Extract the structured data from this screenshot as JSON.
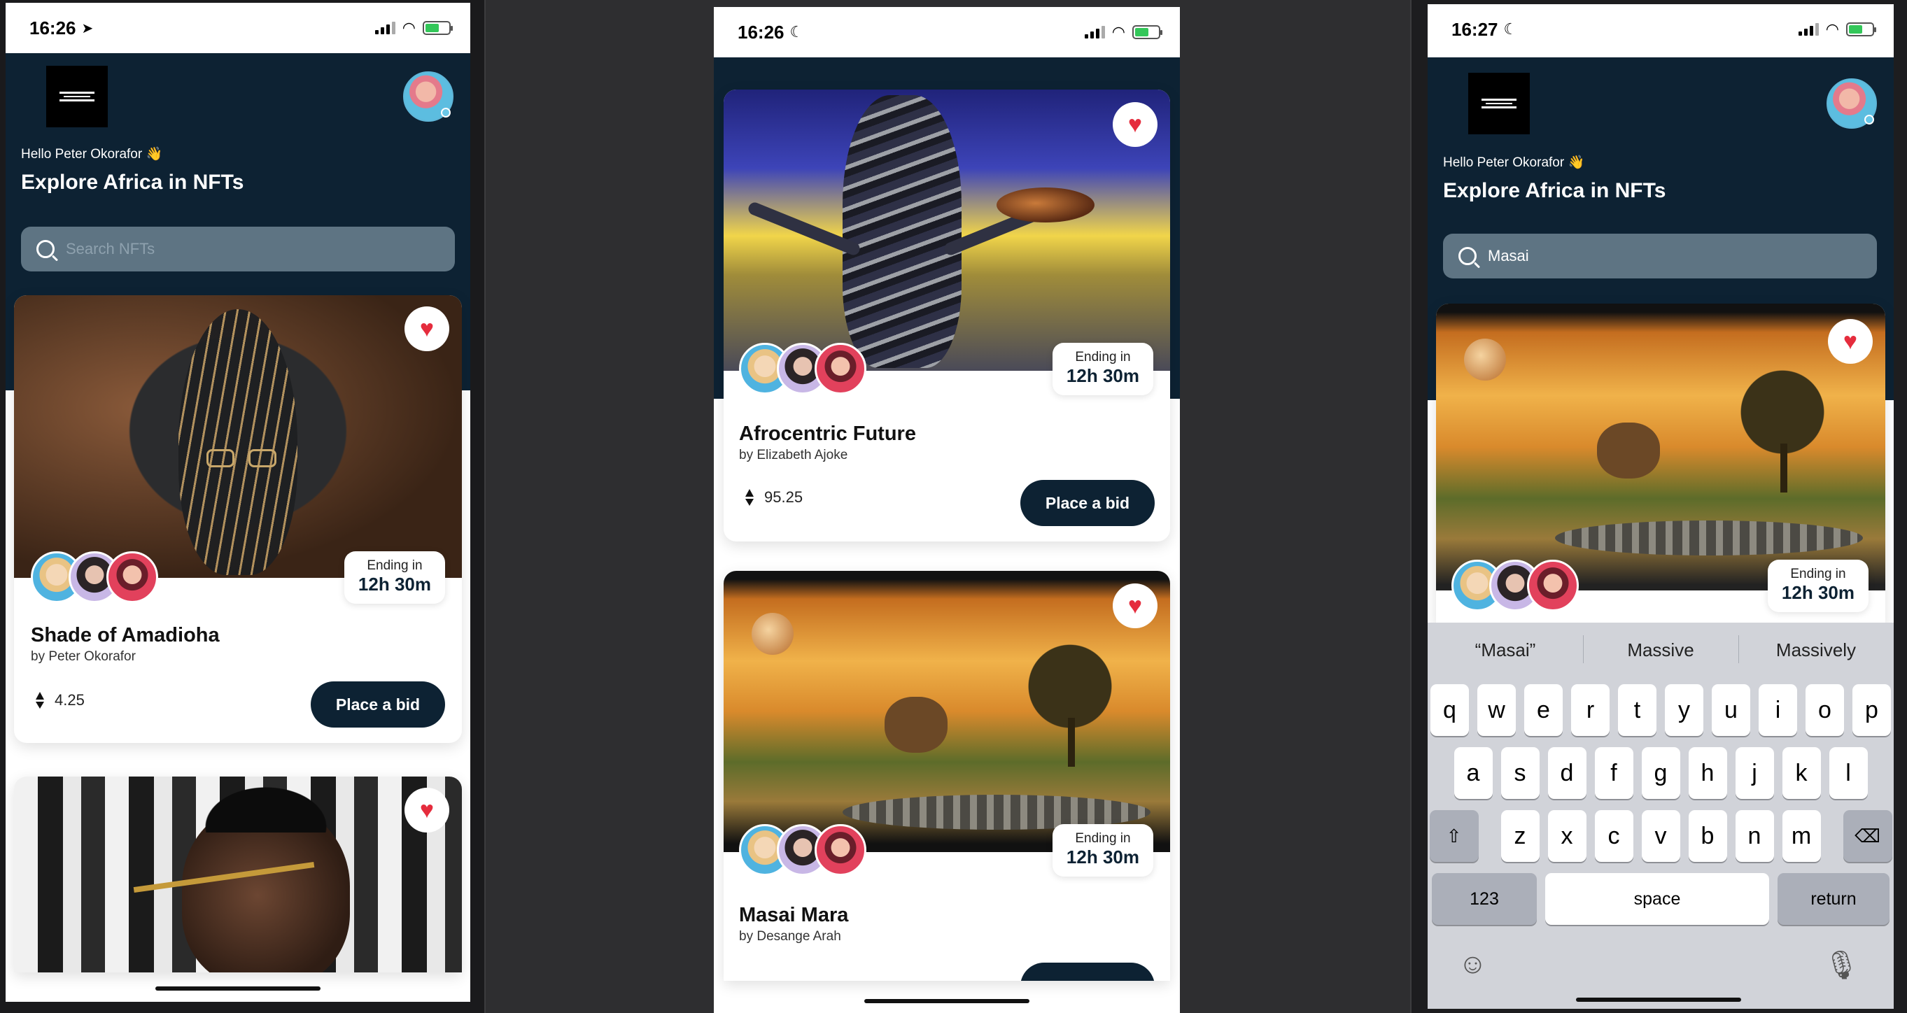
{
  "screens": [
    {
      "time": "16:26",
      "greeting": "Hello Peter Okorafor 👋",
      "headline": "Explore Africa in NFTs",
      "search_placeholder": "Search NFTs",
      "cards": [
        {
          "title": "Shade of Amadioha",
          "byline": "by Peter Okorafor",
          "ending_label": "Ending in",
          "ending_time": "12h 30m",
          "price": "4.25",
          "bid_label": "Place a bid"
        }
      ]
    },
    {
      "time": "16:26",
      "cards": [
        {
          "title": "Afrocentric Future",
          "byline": "by Elizabeth Ajoke",
          "ending_label": "Ending in",
          "ending_time": "12h 30m",
          "price": "95.25",
          "bid_label": "Place a bid"
        },
        {
          "title": "Masai Mara",
          "byline": "by Desange Arah",
          "ending_label": "Ending in",
          "ending_time": "12h 30m"
        }
      ]
    },
    {
      "time": "16:27",
      "greeting": "Hello Peter Okorafor 👋",
      "headline": "Explore Africa in NFTs",
      "search_value": "Masai",
      "cards": [
        {
          "ending_label": "Ending in",
          "ending_time": "12h 30m"
        }
      ],
      "keyboard": {
        "suggestions": [
          "“Masai”",
          "Massive",
          "Massively"
        ],
        "row1": [
          "q",
          "w",
          "e",
          "r",
          "t",
          "y",
          "u",
          "i",
          "o",
          "p"
        ],
        "row2": [
          "a",
          "s",
          "d",
          "f",
          "g",
          "h",
          "j",
          "k",
          "l"
        ],
        "row3": [
          "z",
          "x",
          "c",
          "v",
          "b",
          "n",
          "m"
        ],
        "numbers_label": "123",
        "space_label": "space",
        "return_label": "return"
      }
    }
  ],
  "colors": {
    "header_navy": "#0d2233",
    "heart_red": "#e52c3d",
    "button_navy": "#0d2233"
  }
}
